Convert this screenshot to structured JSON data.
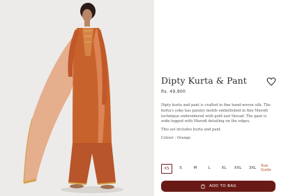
{
  "product": {
    "name": "Dipty Kurta & Pant",
    "price": "Rs. 49,900",
    "description": "Dipty kurta and pant is crafted in fine hand-woven silk. The kurta's yoke has paisley motifs embellished in fine Marodi technique embroidered with gold zari thread. The pant is wide-legged with Marodi detailing on the edges.",
    "set_note": "This set includes kurta and pant.",
    "colour": "Colour : Orange",
    "image_alt": "Model wearing orange silk kurta, pant and sheer dupatta"
  },
  "sizes": {
    "options": [
      "XS",
      "S",
      "M",
      "L",
      "XL",
      "XXL",
      "3XL"
    ],
    "selected": "XS",
    "guide_label_1": "Size",
    "guide_label_2": "Guide"
  },
  "actions": {
    "add_to_bag": "ADD TO BAG",
    "wishlist_icon": "heart-icon",
    "bag_icon": "shopping-bag-icon"
  },
  "colors": {
    "accent": "#6a1a16",
    "size_guide": "#b04a1e",
    "garment": "#c8622c"
  }
}
